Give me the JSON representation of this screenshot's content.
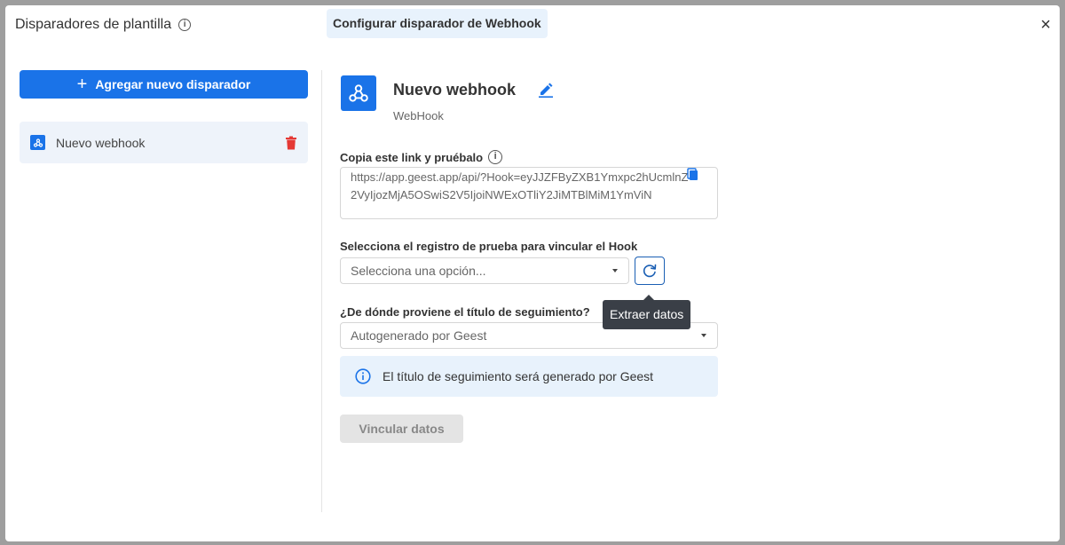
{
  "header": {
    "title": "Disparadores de plantilla",
    "active_tab": "Configurar disparador de Webhook",
    "close_label": "×"
  },
  "sidebar": {
    "add_button_label": "Agregar nuevo disparador",
    "items": [
      {
        "label": "Nuevo webhook"
      }
    ]
  },
  "main": {
    "webhook_name": "Nuevo webhook",
    "webhook_type": "WebHook",
    "link_label": "Copia este link y pruébalo",
    "link_value": "https://app.geest.app/api/?Hook=eyJJZFByZXB1Ymxpc2hUcmlnZ2VyIjozMjA5OSwiS2V5IjoiNWExOTliY2JiMTBlMiM1YmViN",
    "test_record_label": "Selecciona el registro de prueba para vincular el Hook",
    "test_record_placeholder": "Selecciona una opción...",
    "refresh_tooltip": "Extraer datos",
    "title_source_label": "¿De dónde proviene el título de seguimiento?",
    "title_source_value": "Autogenerado por Geest",
    "info_message": "El título de seguimiento será generado por Geest",
    "link_data_button": "Vincular datos"
  },
  "colors": {
    "primary": "#1a73e8",
    "info_bg": "#e8f2fc",
    "danger": "#e53935",
    "tooltip_bg": "#3a3f47"
  }
}
